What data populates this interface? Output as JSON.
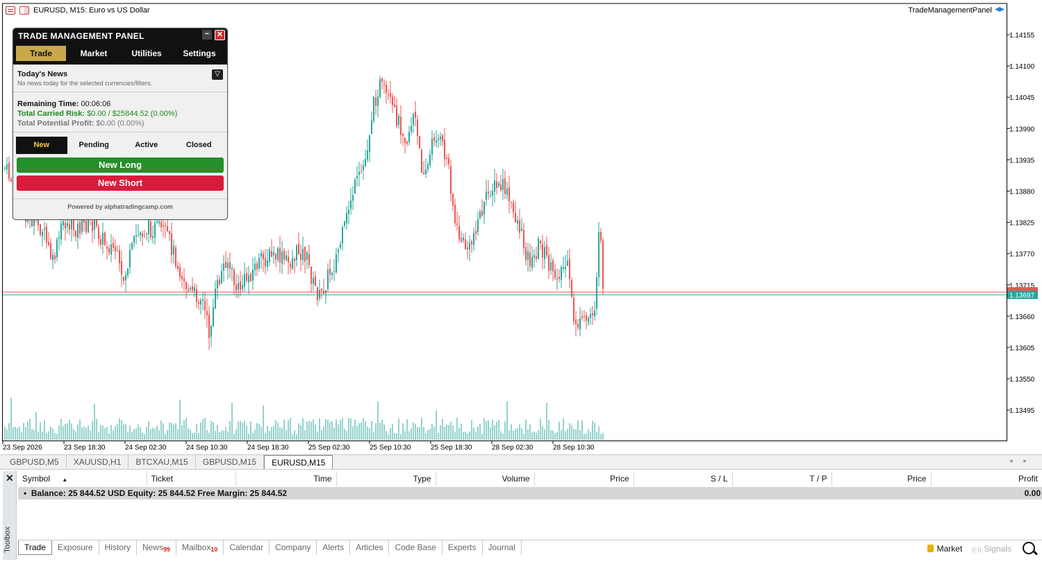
{
  "chart": {
    "title": "EURUSD, M15:  Euro vs US Dollar",
    "ea_label": "TradeManagementPanel",
    "price_labels": [
      "1.14155",
      "1.14100",
      "1.14045",
      "1.13990",
      "1.13935",
      "1.13880",
      "1.13825",
      "1.13770",
      "1.13715",
      "1.13660",
      "1.13605",
      "1.13550",
      "1.13495"
    ],
    "bid_price": "1.13697",
    "time_labels": [
      "23 Sep 2026",
      "23 Sep 18:30",
      "24 Sep 02:30",
      "24 Sep 10:30",
      "24 Sep 18:30",
      "25 Sep 02:30",
      "25 Sep 10:30",
      "25 Sep 18:30",
      "28 Sep 02:30",
      "28 Sep 10:30"
    ],
    "colors": {
      "bull": "#26a69a",
      "bear": "#ef5350",
      "ask_line": "#ef5350",
      "bid_line": "#26a69a"
    }
  },
  "panel": {
    "title": "TRADE MANAGEMENT PANEL",
    "minimize": "−",
    "close": "✕",
    "tabs": [
      "Trade",
      "Market",
      "Utilities",
      "Settings"
    ],
    "news_title": "Today's News",
    "news_sub": "No news today for the selected currencies/filters.",
    "filter_icon": "▽",
    "remaining_label": "Remaining Time:",
    "remaining_value": "00:06:06",
    "risk_label": "Total Carried Risk:",
    "risk_value": "$0.00 / $25844.52 (0.00%)",
    "profit_label": "Total Potential Profit:",
    "profit_value": "$0.00 (0.00%)",
    "order_tabs": [
      "New",
      "Pending",
      "Active",
      "Closed"
    ],
    "new_long": "New Long",
    "new_short": "New Short",
    "powered": "Powered by alphatradingcamp.com",
    "colors": {
      "active_tab": "#c9a84c",
      "long": "#23902a",
      "short": "#d91c3c"
    }
  },
  "chart_tabs": [
    "GBPUSD,M5",
    "XAUUSD,H1",
    "BTCXAU,M15",
    "GBPUSD,M15",
    "EURUSD,M15"
  ],
  "toolbox": {
    "close": "✕",
    "label": "Toolbox",
    "columns": [
      "Symbol",
      "Ticket",
      "Time",
      "Type",
      "Volume",
      "Price",
      "S / L",
      "T / P",
      "Price",
      "Profit"
    ],
    "sort_icon": "▲",
    "balance_text": "Balance: 25 844.52 USD  Equity: 25 844.52  Free Margin: 25 844.52",
    "balance_profit": "0.00",
    "tabs": [
      {
        "label": "Trade",
        "badge": ""
      },
      {
        "label": "Exposure",
        "badge": ""
      },
      {
        "label": "History",
        "badge": ""
      },
      {
        "label": "News",
        "badge": "99"
      },
      {
        "label": "Mailbox",
        "badge": "10"
      },
      {
        "label": "Calendar",
        "badge": ""
      },
      {
        "label": "Company",
        "badge": ""
      },
      {
        "label": "Alerts",
        "badge": ""
      },
      {
        "label": "Articles",
        "badge": ""
      },
      {
        "label": "Code Base",
        "badge": ""
      },
      {
        "label": "Experts",
        "badge": ""
      },
      {
        "label": "Journal",
        "badge": ""
      }
    ],
    "market": "Market",
    "signals": "Signals"
  }
}
